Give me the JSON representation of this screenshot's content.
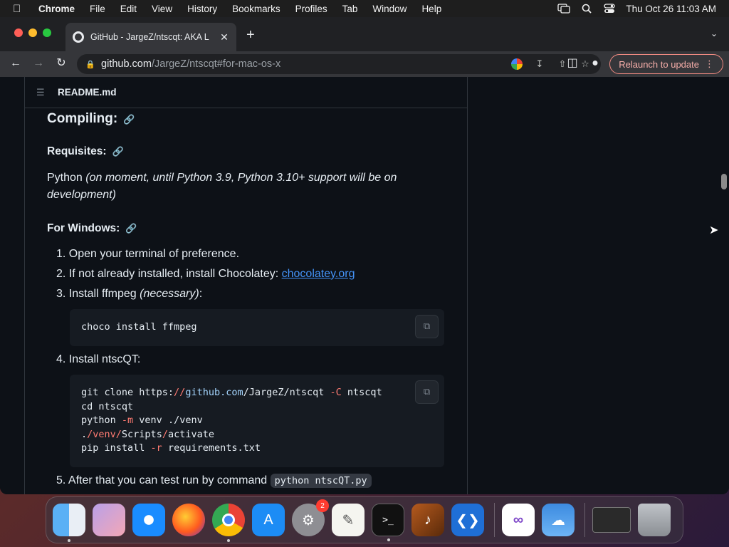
{
  "menubar": {
    "app": "Chrome",
    "items": [
      "File",
      "Edit",
      "View",
      "History",
      "Bookmarks",
      "Profiles",
      "Tab",
      "Window",
      "Help"
    ],
    "clock": "Thu Oct 26  11:03 AM"
  },
  "browser": {
    "tab_title": "GitHub - JargeZ/ntscqt: AKA L",
    "url_host": "github.com",
    "url_path": "/JargeZ/ntscqt#for-mac-os-x",
    "relaunch": "Relaunch to update"
  },
  "readme": {
    "file_label": "README.md",
    "compiling": "Compiling:",
    "requisites": "Requisites:",
    "python_prefix": "Python ",
    "python_note": "(on moment, until Python 3.9, Python 3.10+ support will be on development)",
    "for_windows": "For Windows:",
    "steps": {
      "s1": "1. Open your terminal of preference.",
      "s2_text": "2. If not already installed, install Chocolatey: ",
      "s2_link": "chocolatey.org",
      "s3_text": "3. Install ffmpeg ",
      "s3_em": "(necessary)",
      "s3_tail": ":",
      "s4": "4. Install ntscQT:",
      "s5_text": "5. After that you can test run by command ",
      "s5_code": "python ntscQT.py"
    },
    "code1": "choco install ffmpeg",
    "code2": {
      "l1_a": "git clone https:",
      "l1_b": "//",
      "l1_c": "github.com",
      "l1_d": "/JargeZ/",
      "l1_e": "ntscqt ",
      "l1_f": "-C",
      "l1_g": " ntscqt",
      "l2": "cd ntscqt",
      "l3_a": "python ",
      "l3_b": "-m",
      "l3_c": " venv ./venv",
      "l4_a": ".",
      "l4_b": "/venv/",
      "l4_c": "Scripts",
      "l4_d": "/",
      "l4_e": "activate",
      "l5_a": "pip install ",
      "l5_b": "-r",
      "l5_c": " requirements.txt"
    }
  },
  "dock": {
    "apps": [
      "Finder",
      "Launchpad",
      "Safari",
      "Firefox",
      "Chrome",
      "App Store",
      "System Settings",
      "TextEdit",
      "Terminal",
      "GarageBand",
      "VS Code",
      "Visual Studio",
      "Weather",
      "Window",
      "Trash"
    ],
    "settings_badge": "2"
  },
  "icons": [
    "apple-icon",
    "lock-icon",
    "link-icon",
    "copy-icon",
    "list-icon",
    "search-icon"
  ]
}
